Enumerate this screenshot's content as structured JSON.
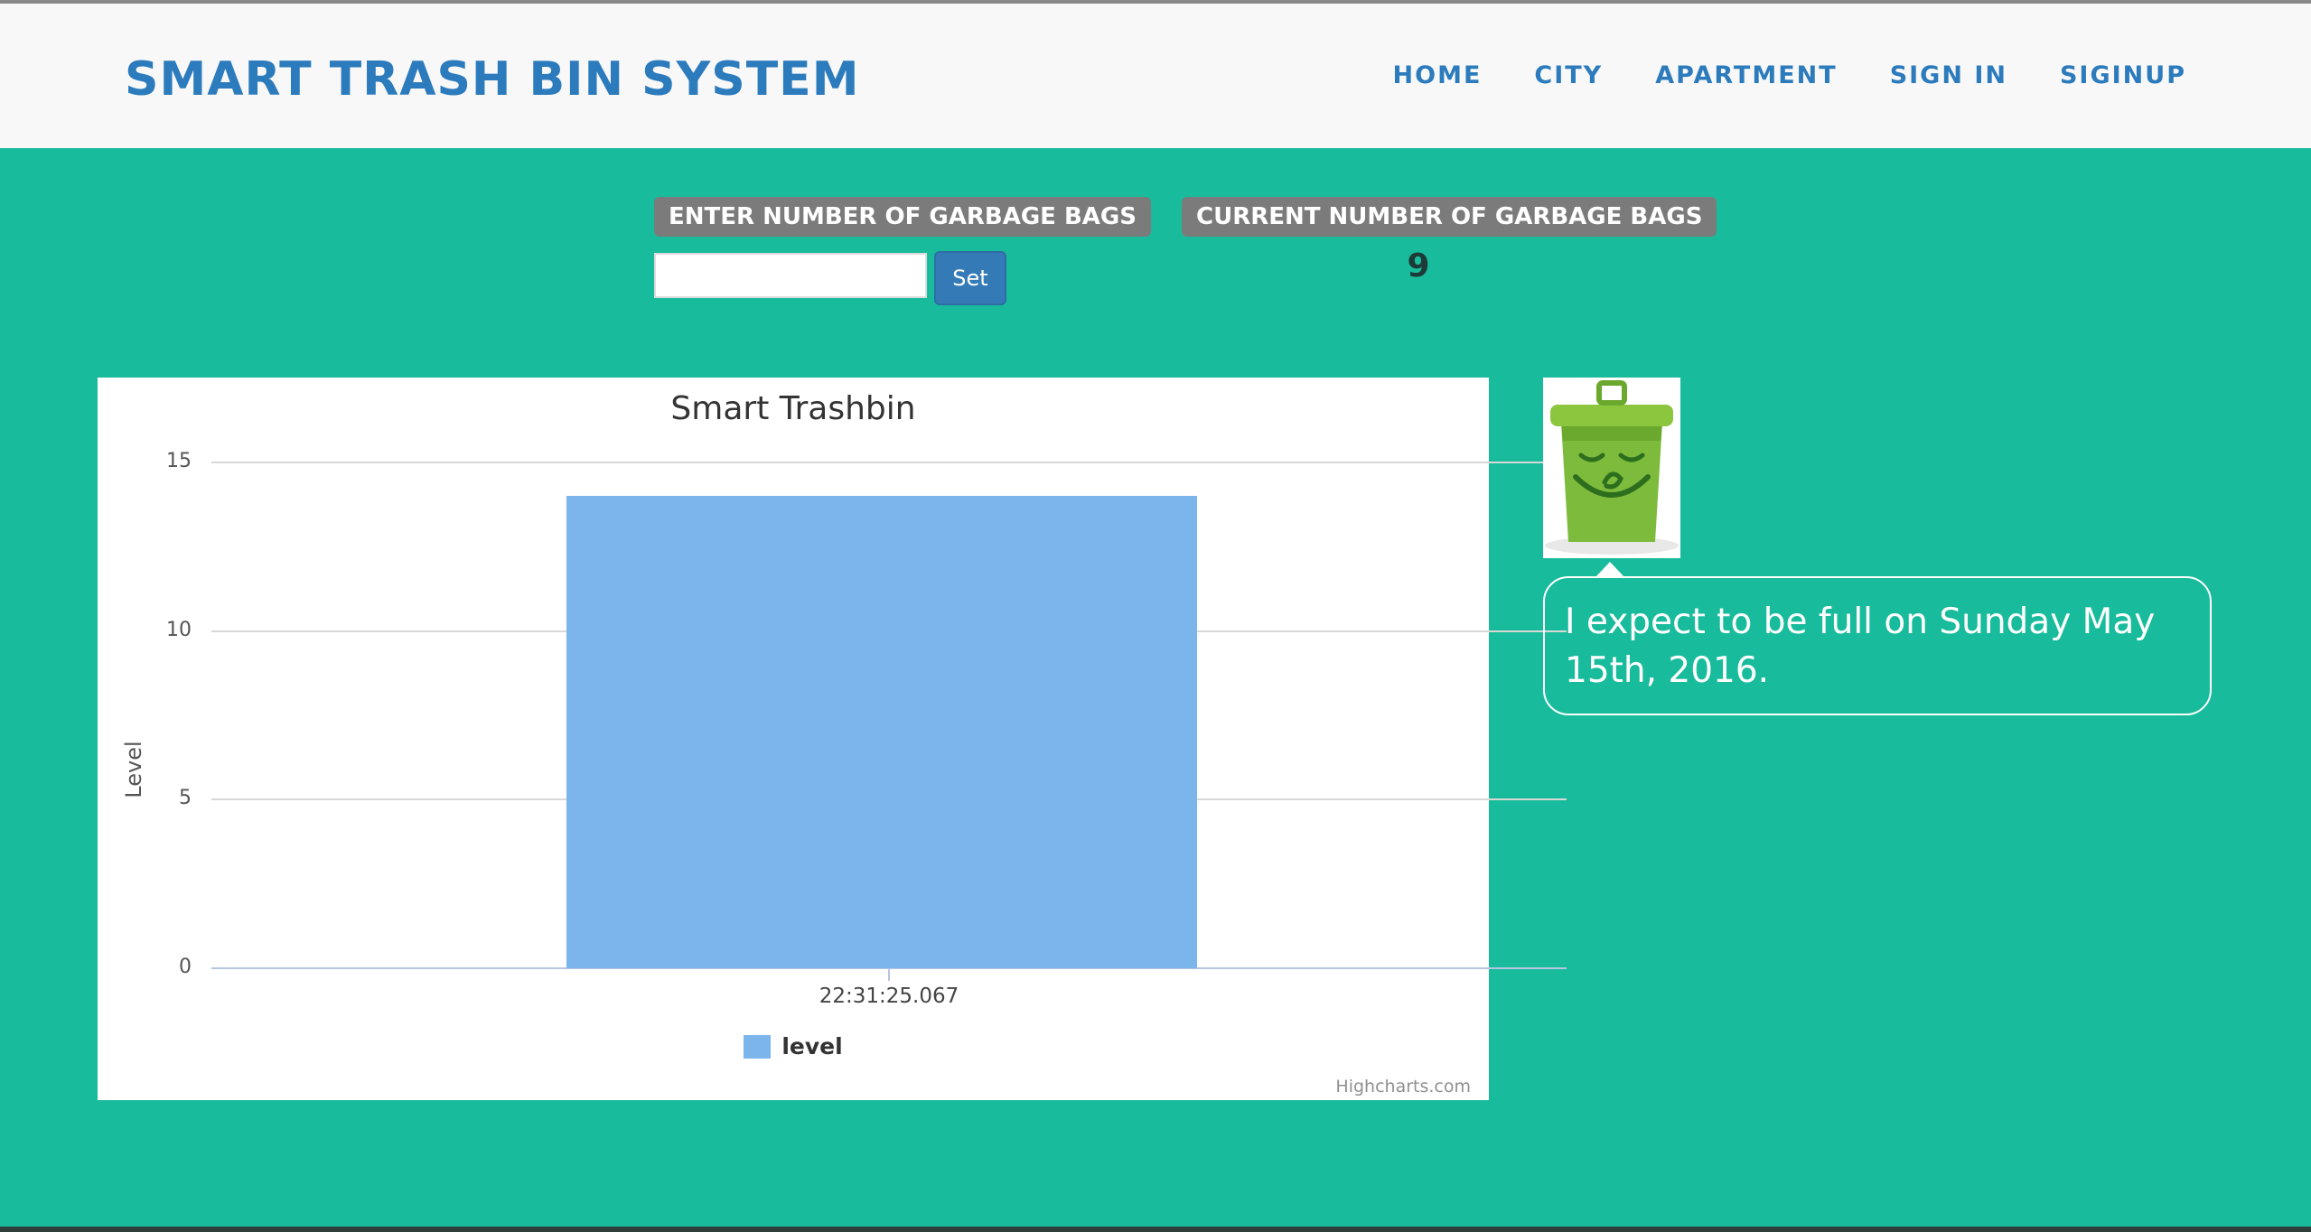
{
  "header": {
    "brand": "SMART TRASH BIN SYSTEM",
    "nav": [
      "HOME",
      "CITY",
      "APARTMENT",
      "SIGN IN",
      "SIGINUP"
    ]
  },
  "controls": {
    "enter_label": "ENTER NUMBER OF GARBAGE BAGS",
    "input_value": "",
    "set_button": "Set",
    "current_label": "CURRENT NUMBER OF GARBAGE BAGS",
    "current_value": "9"
  },
  "chart_data": {
    "type": "bar",
    "title": "Smart Trashbin",
    "xlabel": "",
    "ylabel": "Level",
    "categories": [
      "22:31:25.067"
    ],
    "series": [
      {
        "name": "level",
        "values": [
          14
        ],
        "color": "#7cb5ec"
      }
    ],
    "ylim": [
      0,
      15
    ],
    "yticks": [
      "0",
      "5",
      "10",
      "15"
    ],
    "grid": true,
    "legend": "bottom-center",
    "credits": "Highcharts.com"
  },
  "status": {
    "message": "I expect to be full on Sunday May 15th, 2016."
  },
  "colors": {
    "background": "#18bc9c",
    "navbar": "#f8f8f8",
    "brand": "#2c7bbd",
    "label_box": "#7b7b7b",
    "button": "#337ab7",
    "bar": "#7cb5ec"
  }
}
